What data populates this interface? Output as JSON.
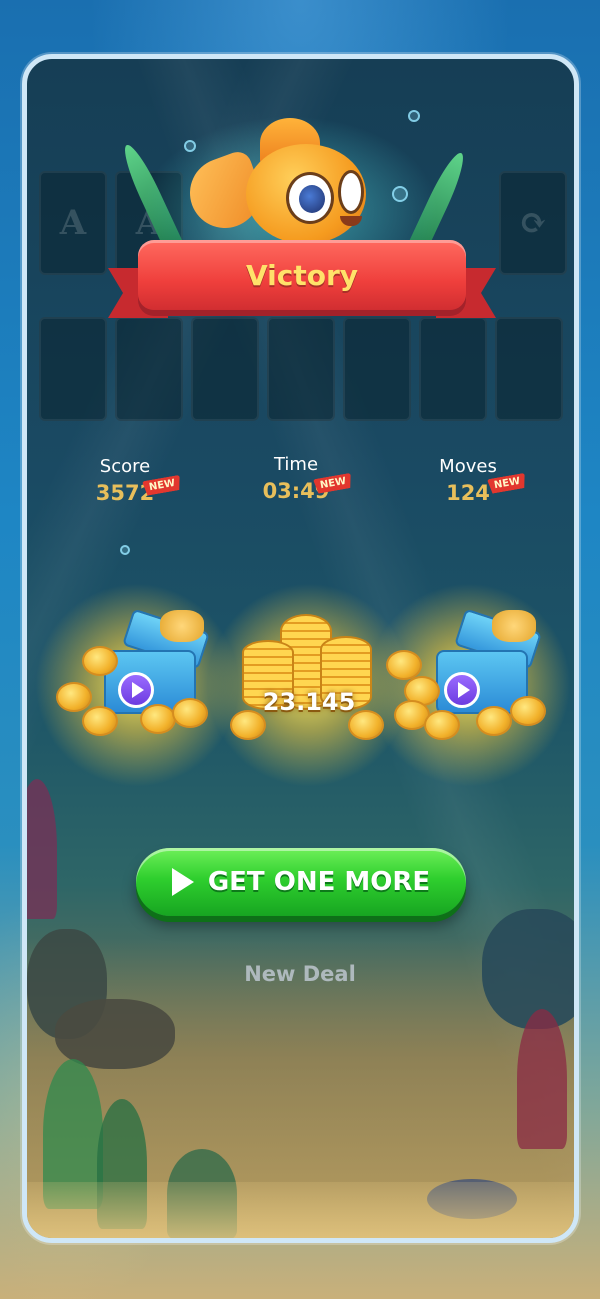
{
  "banner": {
    "title": "Victory"
  },
  "card_slots": {
    "top_row": [
      "A",
      "A",
      "",
      "",
      "",
      "",
      ""
    ],
    "recycle_icon": "recycle-icon"
  },
  "stats": [
    {
      "label": "Score",
      "value": "3572",
      "badge": "NEW"
    },
    {
      "label": "Time",
      "value": "03:49",
      "badge": "NEW"
    },
    {
      "label": "Moves",
      "value": "124",
      "badge": "NEW"
    }
  ],
  "rewards": {
    "left": {
      "type": "gift-video",
      "icon": "play-video-icon"
    },
    "center": {
      "type": "coins",
      "amount": "23.145"
    },
    "right": {
      "type": "gift-video",
      "icon": "play-video-icon"
    }
  },
  "actions": {
    "primary_label": "GET ONE MORE",
    "secondary_label": "New Deal"
  },
  "colors": {
    "banner_red": "#ef3f3c",
    "banner_text": "#ffe26a",
    "stat_value": "#e8bf5b",
    "cta_green": "#2fcf2e",
    "panel_border": "#cfe7f7"
  }
}
